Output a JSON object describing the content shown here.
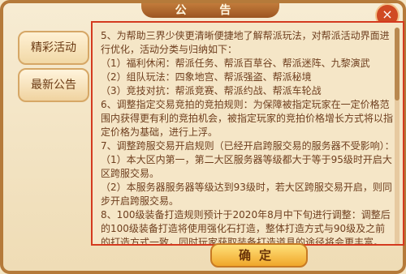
{
  "window": {
    "title": "公 告",
    "close_icon": "×"
  },
  "sidebar": {
    "items": [
      {
        "label": "精彩活动"
      },
      {
        "label": "最新公告"
      }
    ]
  },
  "content": {
    "lines": [
      "5、为帮助三界少侠更清晰便捷地了解帮派玩法，对帮派活动界面进行优化，活动分类与归纳如下：",
      "（1）福利休闲：帮派任务、帮派百草谷、帮派迷阵、九黎演武",
      "（2）组队玩法：四象地宫、帮派强盗、帮派秘境",
      "（3）竞技对抗：帮派竞赛、帮派约战、帮派车轮战",
      "6、调整指定交易竞拍的竞拍规则：为保障被指定玩家在一定价格范围内获得更有利的竞拍机会，被指定玩家的竞拍价格增长方式将以指定价格为基础，进行上浮。",
      "7、调整跨服交易开启规则（已经开启跨服交易的服务器不受影响）：",
      "（1）本大区内第一，第二大区服务器等级都大于等于95级时开启大区跨服交易。",
      "（2）本服务器服务器等级达到93级时，若大区跨服交易开启，则同步开启跨服交易。",
      "8、100级装备打造规则预计于2020年8月中下旬进行调整：调整后的100级装备打造将使用强化石打造，整体打造方式与90级及之前的打造方式一致，同时玩家获取装备打造道具的途径将会更丰富。"
    ]
  },
  "footer": {
    "confirm_label": "确定"
  }
}
